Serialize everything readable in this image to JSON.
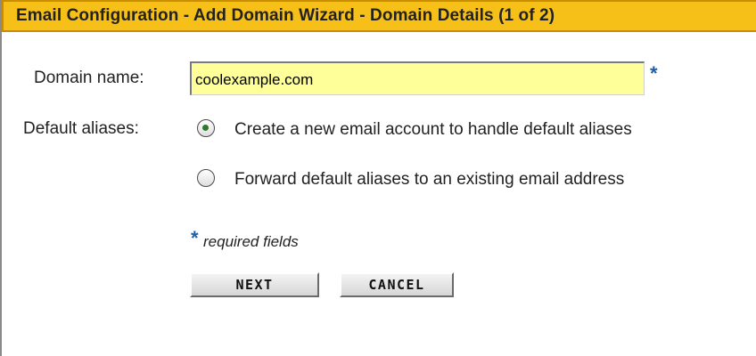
{
  "header": {
    "title": "Email Configuration - Add Domain Wizard - Domain Details (1 of 2)"
  },
  "form": {
    "domain_label": "Domain name:",
    "domain_value": "coolexample.com",
    "required_marker": "*",
    "aliases_label": "Default aliases:",
    "alias_options": [
      {
        "label": "Create a new email account to handle default aliases",
        "selected": true
      },
      {
        "label": "Forward default aliases to an existing email address",
        "selected": false
      }
    ],
    "required_note": "required fields"
  },
  "buttons": {
    "next_label": "NEXT",
    "cancel_label": "CANCEL"
  },
  "colors": {
    "header_bg": "#f6c018",
    "input_bg": "#ffff99",
    "required_marker": "#1f5ea8"
  }
}
